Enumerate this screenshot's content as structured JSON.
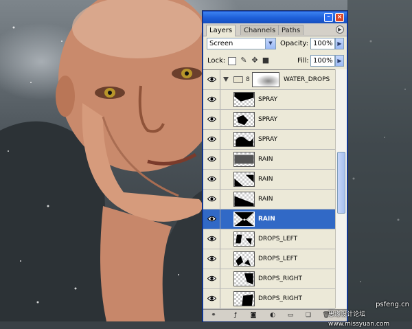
{
  "panel": {
    "tabs": [
      "Layers",
      "Channels",
      "Paths"
    ],
    "blend_mode": "Screen",
    "opacity_label": "Opacity:",
    "opacity_value": "100%",
    "lock_label": "Lock:",
    "fill_label": "Fill:",
    "fill_value": "100%"
  },
  "layers": [
    {
      "name": "WATER_DROPS",
      "type": "group"
    },
    {
      "name": "SPRAY",
      "type": "layer"
    },
    {
      "name": "SPRAY",
      "type": "layer"
    },
    {
      "name": "SPRAY",
      "type": "layer"
    },
    {
      "name": "RAIN",
      "type": "layer"
    },
    {
      "name": "RAIN",
      "type": "layer"
    },
    {
      "name": "RAIN",
      "type": "layer"
    },
    {
      "name": "RAIN",
      "type": "layer",
      "selected": true
    },
    {
      "name": "DROPS_LEFT",
      "type": "layer"
    },
    {
      "name": "DROPS_LEFT",
      "type": "layer"
    },
    {
      "name": "DROPS_RIGHT",
      "type": "layer"
    },
    {
      "name": "DROPS_RIGHT",
      "type": "layer"
    }
  ],
  "watermark": {
    "line1": "思缘设计论坛 www.missyuan.com",
    "line2": "psfeng.cn"
  },
  "colors": {
    "titlebar": "#1d5ed8",
    "selected_row": "#3169c6",
    "panel_bg": "#ece9d8"
  }
}
